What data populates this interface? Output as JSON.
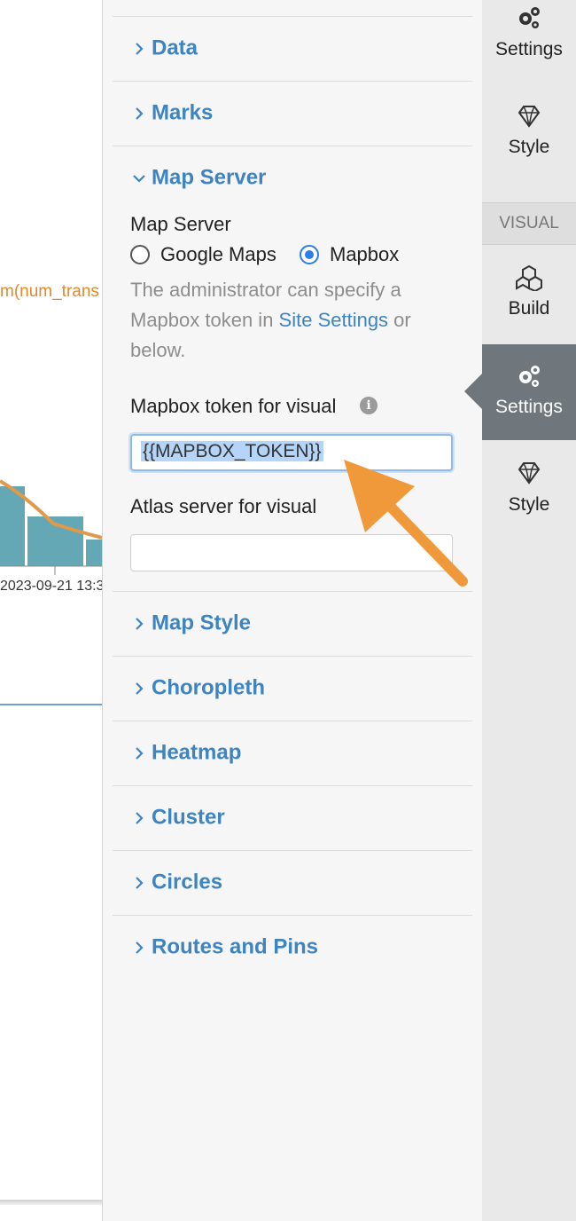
{
  "chart": {
    "series_label": "m(num_trans",
    "x_tick_label": "2023-09-21 13:3",
    "colors": {
      "bar": "#63a8b4",
      "line": "#e09a4a",
      "axis": "#3d84c0"
    }
  },
  "panel": {
    "sections_top": [
      {
        "label": "Data",
        "expanded": false
      },
      {
        "label": "Marks",
        "expanded": false
      },
      {
        "label": "Map Server",
        "expanded": true
      }
    ],
    "map_server": {
      "label": "Map Server",
      "options": [
        {
          "label": "Google Maps",
          "selected": false
        },
        {
          "label": "Mapbox",
          "selected": true
        }
      ],
      "help_text_before": "The administrator can specify a Mapbox token in ",
      "help_link": "Site Settings",
      "help_text_after": " or below.",
      "token_label": "Mapbox token for visual",
      "token_value": "{{MAPBOX_TOKEN}}",
      "atlas_label": "Atlas server for visual",
      "atlas_value": ""
    },
    "sections_bottom": [
      {
        "label": "Map Style"
      },
      {
        "label": "Choropleth"
      },
      {
        "label": "Heatmap"
      },
      {
        "label": "Cluster"
      },
      {
        "label": "Circles"
      },
      {
        "label": "Routes and Pins"
      }
    ]
  },
  "sidebar": {
    "top_items": [
      {
        "label": "Settings",
        "icon": "gears-icon"
      },
      {
        "label": "Style",
        "icon": "diamond-icon"
      }
    ],
    "caption": "VISUAL",
    "visual_items": [
      {
        "label": "Build",
        "icon": "cubes-icon",
        "active": false
      },
      {
        "label": "Settings",
        "icon": "gears-icon",
        "active": true
      },
      {
        "label": "Style",
        "icon": "diamond-icon",
        "active": false
      }
    ]
  },
  "accent_colors": {
    "link": "#3d84c0",
    "arrow": "#f0993a",
    "radio": "#2f7bea"
  }
}
